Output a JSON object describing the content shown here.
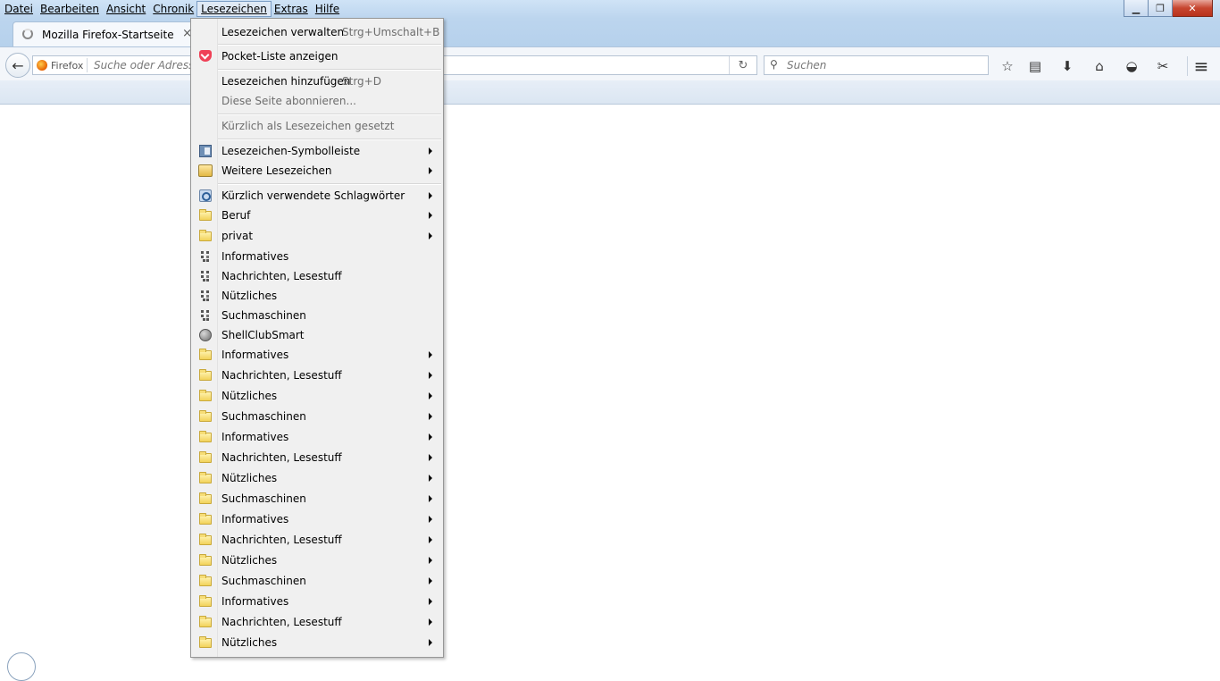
{
  "menubar": {
    "items": [
      "Datei",
      "Bearbeiten",
      "Ansicht",
      "Chronik",
      "Lesezeichen",
      "Extras",
      "Hilfe"
    ],
    "active_index": 4
  },
  "window_controls": {
    "minimize": "▁",
    "maximize": "❐",
    "close": "✕"
  },
  "tab": {
    "title": "Mozilla Firefox-Startseite",
    "close": "×"
  },
  "navbar": {
    "back": "←",
    "identity_label": "Firefox",
    "url_placeholder": "Suche oder Adresse eingeben",
    "reload": "↻",
    "search_placeholder": "Suchen",
    "search_glyph": "⚲",
    "icons": {
      "bookmark_star": "☆",
      "reading_list": "▤",
      "downloads": "⬇",
      "home": "⌂",
      "pocket": "◒",
      "addon": "✂",
      "menu": "≡"
    }
  },
  "dropdown": {
    "items": [
      {
        "label": "Lesezeichen verwalten",
        "accel": "Strg+Umschalt+B"
      },
      {
        "label": "Pocket-Liste anzeigen"
      },
      {
        "label": "Lesezeichen hinzufügen",
        "accel": "Strg+D"
      },
      {
        "label": "Diese Seite abonnieren..."
      },
      {
        "label": "Kürzlich als Lesezeichen gesetzt"
      },
      {
        "label": "Lesezeichen-Symbolleiste"
      },
      {
        "label": "Weitere Lesezeichen"
      },
      {
        "label": "Kürzlich verwendete Schlagwörter"
      },
      {
        "label": "Beruf"
      },
      {
        "label": "privat"
      },
      {
        "label": "Informatives"
      },
      {
        "label": "Nachrichten, Lesestuff"
      },
      {
        "label": "Nützliches"
      },
      {
        "label": "Suchmaschinen"
      },
      {
        "label": "ShellClubSmart"
      },
      {
        "label": "Informatives"
      },
      {
        "label": "Nachrichten, Lesestuff"
      },
      {
        "label": "Nützliches"
      },
      {
        "label": "Suchmaschinen"
      },
      {
        "label": "Informatives"
      },
      {
        "label": "Nachrichten, Lesestuff"
      },
      {
        "label": "Nützliches"
      },
      {
        "label": "Suchmaschinen"
      },
      {
        "label": "Informatives"
      },
      {
        "label": "Nachrichten, Lesestuff"
      },
      {
        "label": "Nützliches"
      },
      {
        "label": "Suchmaschinen"
      },
      {
        "label": "Informatives"
      },
      {
        "label": "Nachrichten, Lesestuff"
      },
      {
        "label": "Nützliches"
      }
    ]
  }
}
